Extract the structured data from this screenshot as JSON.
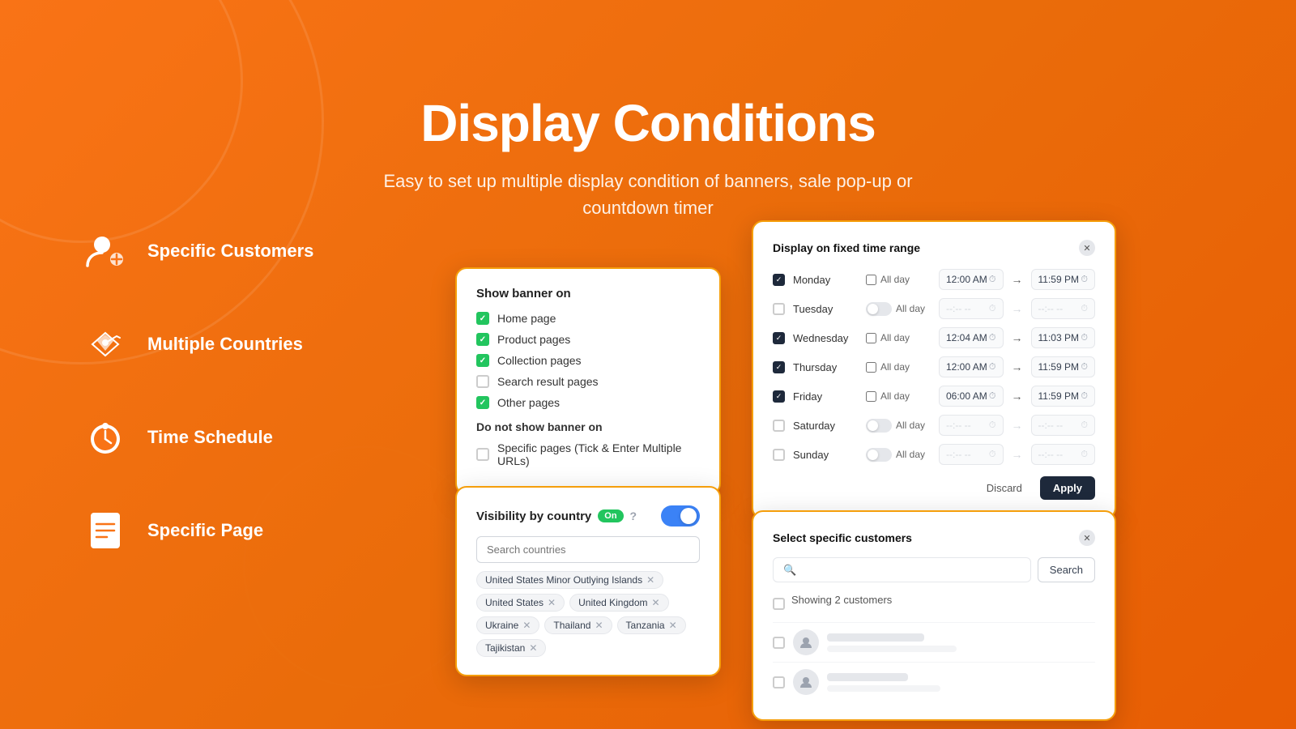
{
  "hero": {
    "title": "Display Conditions",
    "subtitle": "Easy  to set up multiple display condition of banners, sale pop-up or\ncountdown timer"
  },
  "features": [
    {
      "id": "specific-customers",
      "label": "Specific Customers",
      "icon": "👤+"
    },
    {
      "id": "multiple-countries",
      "label": "Multiple Countries",
      "icon": "✈"
    },
    {
      "id": "time-schedule",
      "label": "Time Schedule",
      "icon": "⏰"
    },
    {
      "id": "specific-page",
      "label": "Specific Page",
      "icon": "📄"
    }
  ],
  "show_banner": {
    "title": "Show banner on",
    "items": [
      {
        "label": "Home page",
        "checked": true
      },
      {
        "label": "Product pages",
        "checked": true
      },
      {
        "label": "Collection pages",
        "checked": true
      },
      {
        "label": "Search result pages",
        "checked": false
      },
      {
        "label": "Other pages",
        "checked": true
      }
    ],
    "do_not_show_title": "Do not show banner on",
    "do_not_show_items": [
      {
        "label": "Specific pages (Tick & Enter Multiple URLs)",
        "checked": false
      }
    ]
  },
  "visibility": {
    "title": "Visibility by country",
    "on_label": "On",
    "search_placeholder": "Search countries",
    "tags": [
      "United States Minor Outlying Islands",
      "United States",
      "United Kingdom",
      "Ukraine",
      "Thailand",
      "Tanzania",
      "Tajikistan"
    ]
  },
  "time_schedule": {
    "title": "Display on fixed time range",
    "days": [
      {
        "name": "Monday",
        "checked": true,
        "all_day": false,
        "start": "12:00 AM",
        "end": "11:59 PM",
        "enabled": true
      },
      {
        "name": "Tuesday",
        "checked": false,
        "all_day": false,
        "start": "--:-- --",
        "end": "--:-- --",
        "enabled": false
      },
      {
        "name": "Wednesday",
        "checked": true,
        "all_day": false,
        "start": "12:04 AM",
        "end": "11:03 PM",
        "enabled": true
      },
      {
        "name": "Thursday",
        "checked": true,
        "all_day": false,
        "start": "12:00 AM",
        "end": "11:59 PM",
        "enabled": true
      },
      {
        "name": "Friday",
        "checked": true,
        "all_day": false,
        "start": "06:00 AM",
        "end": "11:59 PM",
        "enabled": true
      },
      {
        "name": "Saturday",
        "checked": false,
        "all_day": false,
        "start": "--:-- --",
        "end": "--:-- --",
        "enabled": false
      },
      {
        "name": "Sunday",
        "checked": false,
        "all_day": false,
        "start": "--:-- --",
        "end": "--:-- --",
        "enabled": false
      }
    ],
    "discard_label": "Discard",
    "apply_label": "Apply"
  },
  "customers": {
    "title": "Select specific customers",
    "search_placeholder": "🔍",
    "search_button": "Search",
    "count_label": "Showing 2 customers"
  }
}
